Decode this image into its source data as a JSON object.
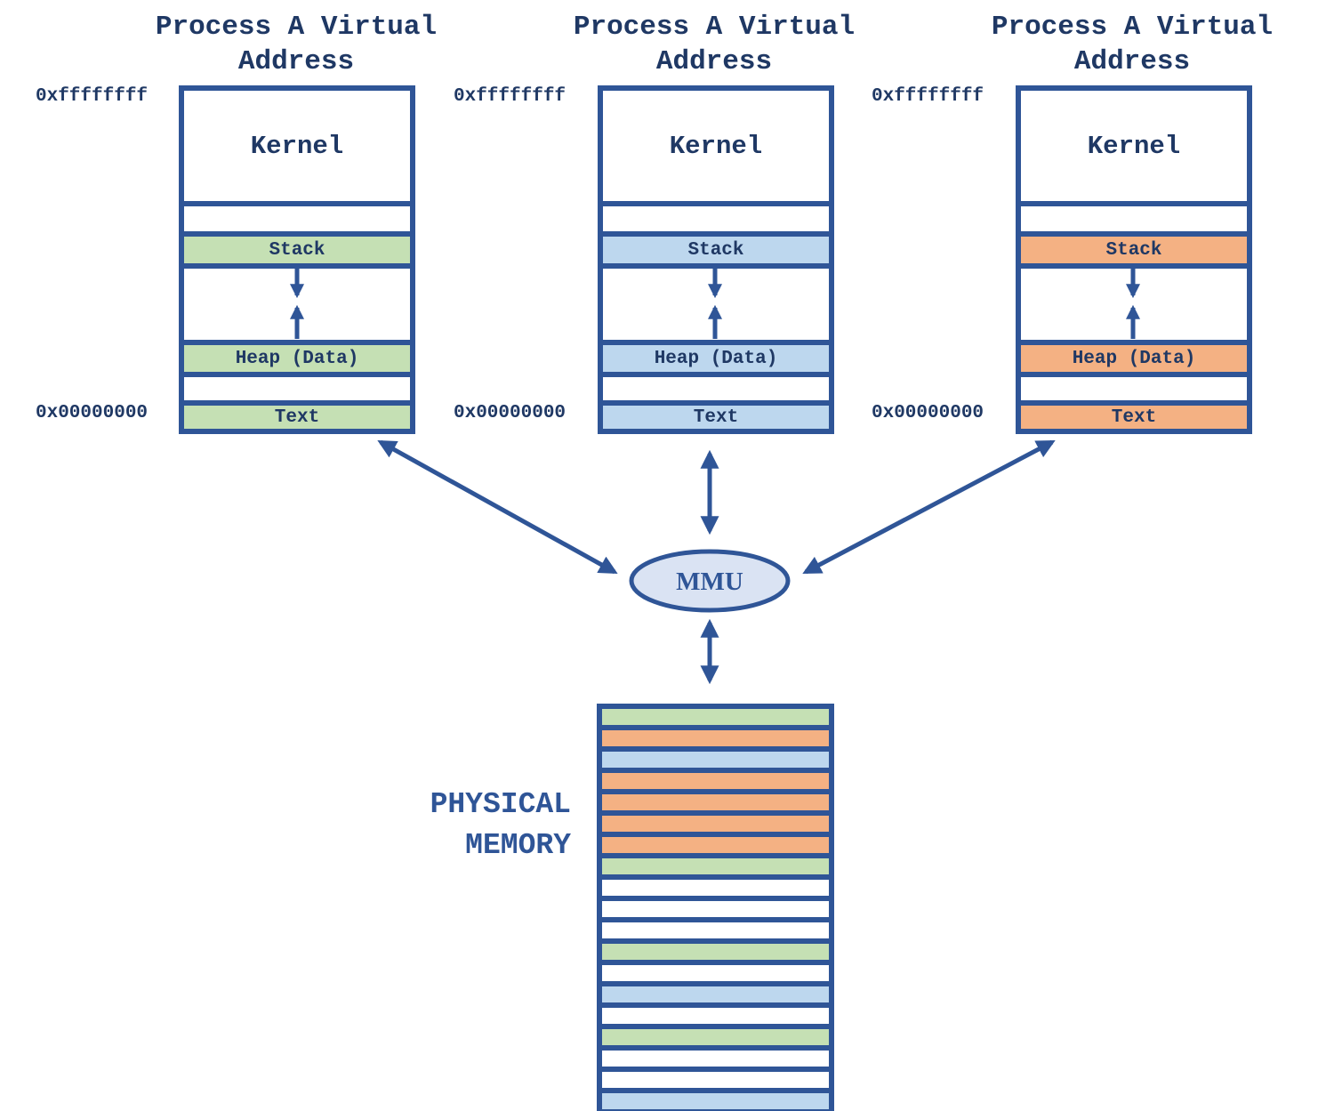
{
  "colors": {
    "border": "#2f5597",
    "text_dark": "#1f3864",
    "green": "#c5e0b4",
    "blue": "#bdd7ee",
    "orange": "#f4b183",
    "white": "#ffffff",
    "mmu_fill": "#dae3f3"
  },
  "processes": [
    {
      "title_line1": "Process A Virtual",
      "title_line2": "Address",
      "addr_high": "0xffffffff",
      "addr_low": "0x00000000",
      "color": "green",
      "segments": {
        "kernel": "Kernel",
        "stack": "Stack",
        "heap": "Heap (Data)",
        "text": "Text"
      }
    },
    {
      "title_line1": "Process A Virtual",
      "title_line2": "Address",
      "addr_high": "0xffffffff",
      "addr_low": "0x00000000",
      "color": "blue",
      "segments": {
        "kernel": "Kernel",
        "stack": "Stack",
        "heap": "Heap (Data)",
        "text": "Text"
      }
    },
    {
      "title_line1": "Process A Virtual",
      "title_line2": "Address",
      "addr_high": "0xffffffff",
      "addr_low": "0x00000000",
      "color": "orange",
      "segments": {
        "kernel": "Kernel",
        "stack": "Stack",
        "heap": "Heap (Data)",
        "text": "Text"
      }
    }
  ],
  "mmu": {
    "label": "MMU"
  },
  "physical_memory": {
    "label_line1": "PHYSICAL",
    "label_line2": "MEMORY",
    "frames": [
      "green",
      "orange",
      "blue",
      "orange",
      "orange",
      "orange",
      "orange",
      "green",
      "white",
      "white",
      "white",
      "green",
      "white",
      "blue",
      "white",
      "green",
      "white",
      "white",
      "blue"
    ]
  }
}
